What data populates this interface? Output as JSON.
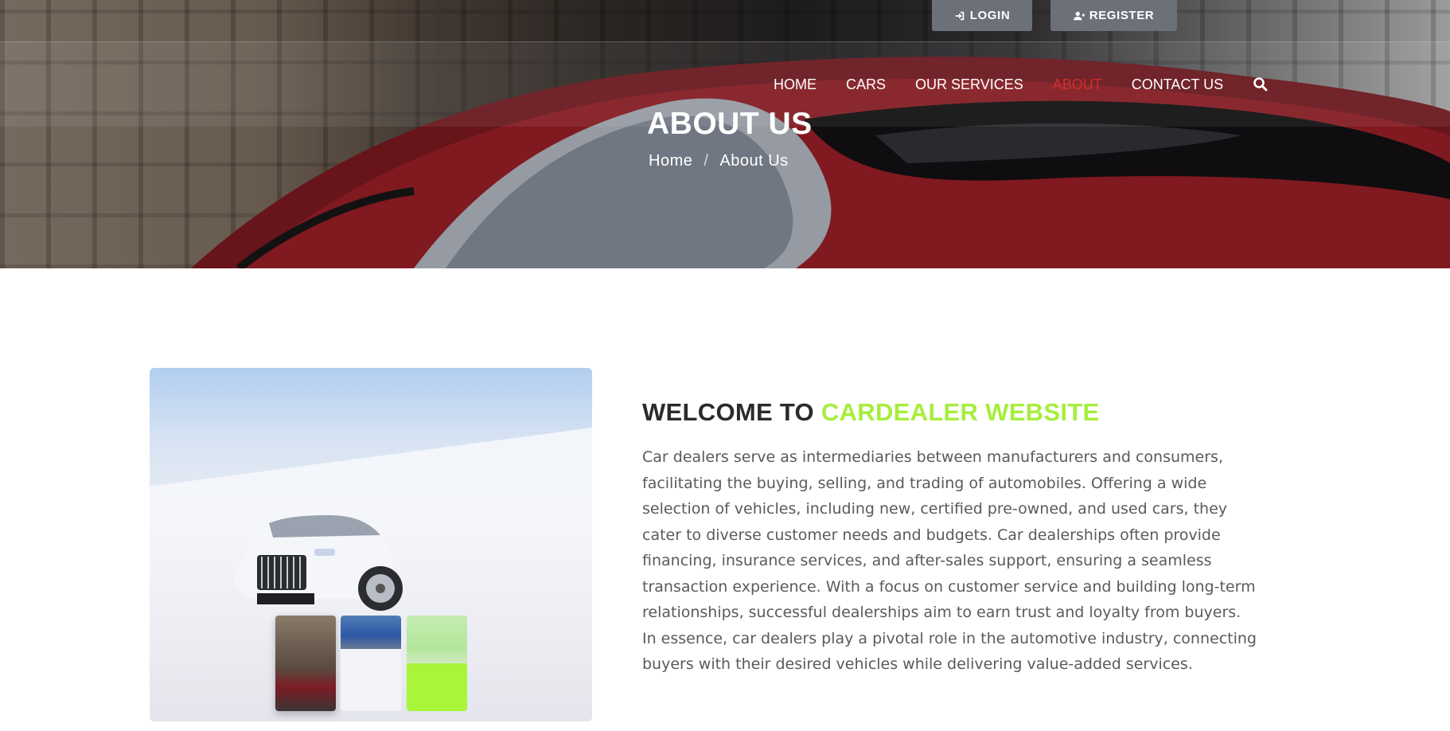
{
  "header": {
    "login_label": "LOGIN",
    "register_label": "REGISTER",
    "nav": [
      {
        "label": "HOME",
        "active": false
      },
      {
        "label": "CARS",
        "active": false
      },
      {
        "label": "OUR SERVICES",
        "active": false
      },
      {
        "label": "ABOUT",
        "active": true
      },
      {
        "label": "CONTACT US",
        "active": false
      }
    ],
    "active_color": "#d42c2c"
  },
  "hero": {
    "title": "ABOUT US",
    "breadcrumb": {
      "home": "Home",
      "separator": "/",
      "current": "About Us"
    }
  },
  "about": {
    "heading_prefix": "WELCOME TO",
    "heading_accent": "CARDEALER WEBSITE",
    "accent_color": "#a6ee3d",
    "body": "Car dealers serve as intermediaries between manufacturers and consumers, facilitating the buying, selling, and trading of automobiles. Offering a wide selection of vehicles, including new, certified pre-owned, and used cars, they cater to diverse customer needs and budgets. Car dealerships often provide financing, insurance services, and after-sales support, ensuring a seamless transaction experience. With a focus on customer service and building long-term relationships, successful dealerships aim to earn trust and loyalty from buyers. In essence, car dealers play a pivotal role in the automotive industry, connecting buyers with their desired vehicles while delivering value-added services."
  },
  "icons": {
    "login": "sign-in-icon",
    "register": "user-plus-icon",
    "search": "search-icon"
  }
}
